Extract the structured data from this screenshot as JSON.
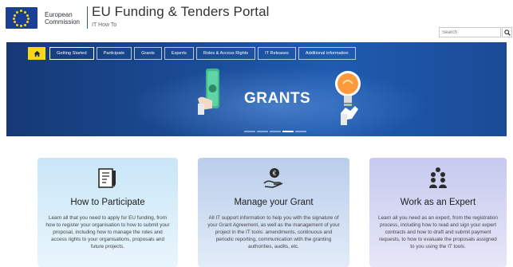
{
  "header": {
    "logo_text_line1": "European",
    "logo_text_line2": "Commission",
    "portal_title": "EU Funding & Tenders Portal",
    "portal_subtitle": "IT How To",
    "search_placeholder": "Search",
    "search_icon": "search-icon"
  },
  "nav": {
    "home_icon": "home-icon",
    "tabs": [
      {
        "label": "Getting Started",
        "active": true
      },
      {
        "label": "Participate"
      },
      {
        "label": "Grants"
      },
      {
        "label": "Experts"
      },
      {
        "label": "Roles & Access Rights"
      },
      {
        "label": "IT Releases"
      },
      {
        "label": "Additional information"
      }
    ]
  },
  "banner": {
    "title": "GRANTS",
    "carousel_count": 5,
    "carousel_active": 4
  },
  "cards": [
    {
      "icon": "document-pencil-icon",
      "title": "How to Participate",
      "text": "Learn all that you need to apply for EU funding, from how to register your organisation to how to submit your proposal, including how to manage the roles and access rights to your organisations, proposals and future projects."
    },
    {
      "icon": "hand-coin-icon",
      "title": "Manage your Grant",
      "text": "All IT support information to help you with the signature of your Grant Agreement, as well as the management of your project in the IT tools: amendments, continuous and periodic reporting, communication with the granting authorities, audits, etc."
    },
    {
      "icon": "expert-group-icon",
      "title": "Work as an Expert",
      "text": "Learn all you need as an expert, from the registration process, including how to read and sign your expert contracts and how to draft and submit payment requests, to how to evaluate the proposals assigned to you using the IT tools."
    }
  ],
  "colors": {
    "brand_blue": "#1a4a93",
    "accent_yellow": "#ffd617",
    "card_participate": "#c9e6f7",
    "card_grant": "#b9cdeb",
    "card_expert": "#c7c9ef"
  }
}
